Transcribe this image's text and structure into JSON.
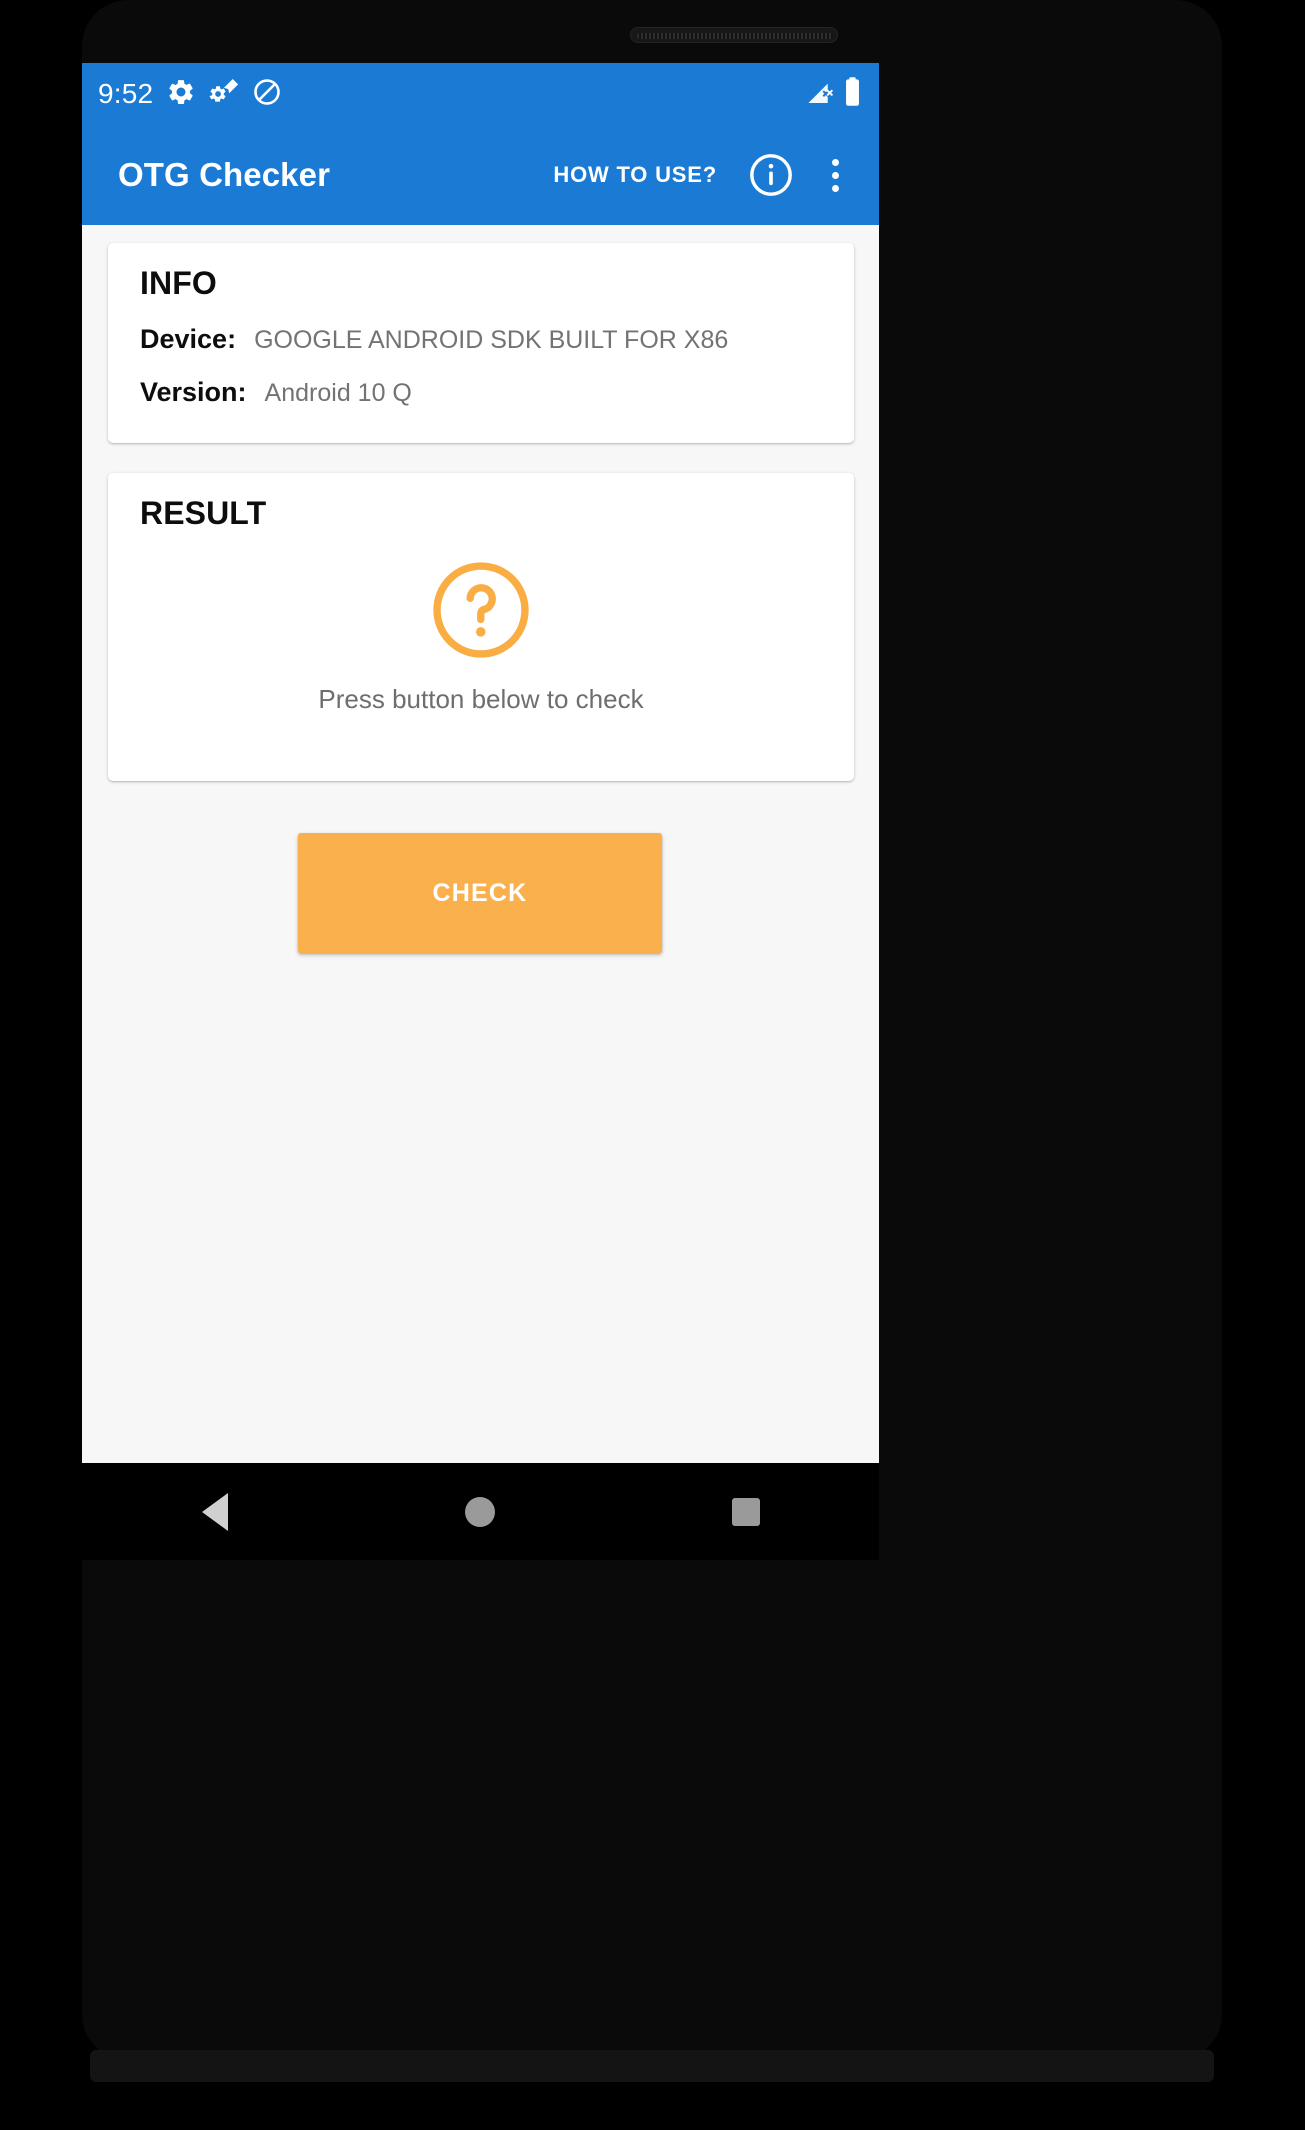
{
  "status_bar": {
    "clock": "9:52",
    "left_icons": [
      "settings-gear-icon",
      "developer-gear-icon",
      "do-not-disturb-icon"
    ],
    "right_icons": [
      "cellular-signal-no-sim-icon",
      "battery-full-icon"
    ]
  },
  "app_bar": {
    "title": "OTG Checker",
    "how_to_use_label": "HOW TO USE?",
    "info_icon": "info-circle-icon",
    "overflow_icon": "more-vert-icon",
    "background_color": "#1a7ad4"
  },
  "info_card": {
    "heading": "INFO",
    "rows": [
      {
        "label": "Device:",
        "value": "GOOGLE ANDROID SDK BUILT FOR X86"
      },
      {
        "label": "Version:",
        "value": "Android 10 Q"
      }
    ]
  },
  "result_card": {
    "heading": "RESULT",
    "status_icon": "question-mark-circle-icon",
    "status_color": "#f9ad43",
    "message": "Press button below to check"
  },
  "check_button": {
    "label": "CHECK",
    "background_color": "#fbb04e",
    "text_color": "#ffffff"
  },
  "nav_bar": {
    "back_label": "back-triangle-icon",
    "home_label": "home-circle-icon",
    "recents_label": "recents-square-icon"
  }
}
